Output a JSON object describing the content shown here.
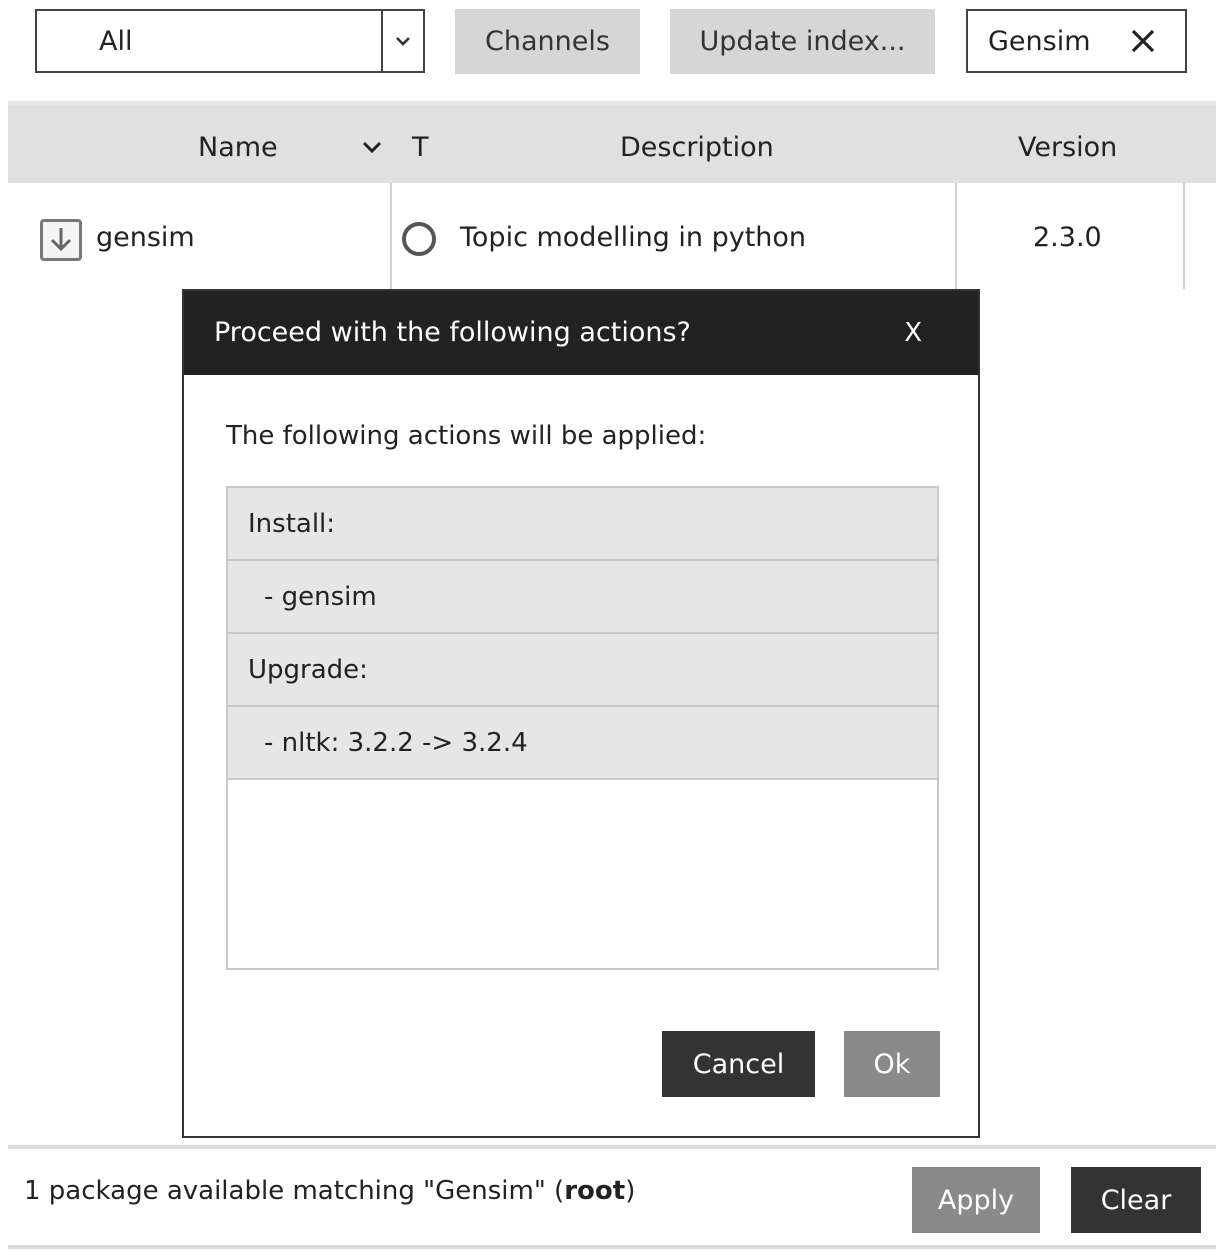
{
  "toolbar": {
    "filter_value": "All",
    "channels_label": "Channels",
    "update_index_label": "Update index...",
    "search_value": "Gensim"
  },
  "table": {
    "headers": {
      "name": "Name",
      "type": "T",
      "description": "Description",
      "version": "Version"
    },
    "rows": [
      {
        "name": "gensim",
        "description": "Topic modelling in python",
        "version": "2.3.0"
      }
    ]
  },
  "modal": {
    "title": "Proceed with the following actions?",
    "close_label": "X",
    "intro": "The following actions will be applied:",
    "actions": [
      "Install:",
      "- gensim",
      "Upgrade:",
      "- nltk: 3.2.2 -> 3.2.4"
    ],
    "cancel_label": "Cancel",
    "ok_label": "Ok"
  },
  "footer": {
    "status_prefix": "1 package available matching \"Gensim\" (",
    "status_env": "root",
    "status_suffix": ")",
    "apply_label": "Apply",
    "clear_label": "Clear"
  }
}
